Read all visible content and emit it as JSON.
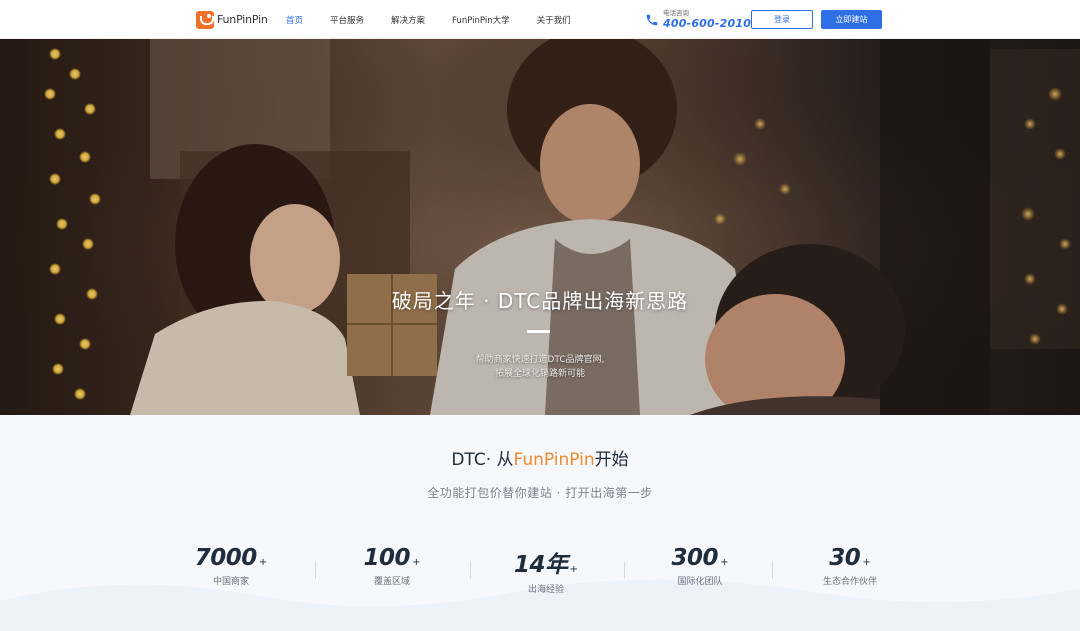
{
  "header": {
    "logo_text": "FunPinPin",
    "nav": [
      {
        "label": "首页",
        "active": true
      },
      {
        "label": "平台服务",
        "active": false
      },
      {
        "label": "解决方案",
        "active": false
      },
      {
        "label": "FunPinPin大学",
        "active": false
      },
      {
        "label": "关于我们",
        "active": false
      }
    ],
    "phone_label": "电话咨询",
    "phone_number": "400-600-2010",
    "login_label": "登录",
    "build_label": "立即建站"
  },
  "hero": {
    "title": "破局之年 · DTC品牌出海新思路",
    "subtitle_line1": "帮助商家快速打造DTC品牌官网,",
    "subtitle_line2": "拓展全球化销路新可能"
  },
  "section": {
    "title_prefix": "DTC· 从",
    "title_brand": "FunPinPin",
    "title_suffix": "开始",
    "subtitle": "全功能打包价替你建站 · 打开出海第一步"
  },
  "stats": [
    {
      "value": "7000",
      "plus": "+",
      "label": "中国商家"
    },
    {
      "value": "100",
      "plus": "+",
      "label": "覆盖区域"
    },
    {
      "value": "14年",
      "plus": "+",
      "label": "出海经验"
    },
    {
      "value": "300",
      "plus": "+",
      "label": "国际化团队"
    },
    {
      "value": "30",
      "plus": "+",
      "label": "生态合作伙伴"
    }
  ],
  "colors": {
    "accent": "#2f6fe6",
    "brand_orange": "#f08a2c",
    "logo_orange": "#f0712c"
  },
  "icons": [
    "logo-icon",
    "phone-icon"
  ]
}
